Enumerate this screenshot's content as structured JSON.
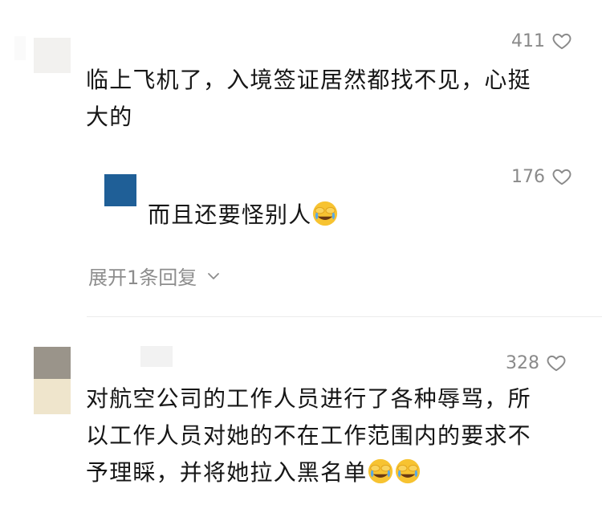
{
  "comments": [
    {
      "likes": "411",
      "text_lines": [
        "临上飞机了，入境签证居然都找不见，心挺",
        "大的"
      ]
    },
    {
      "likes": "176",
      "text": "而且还要怪别人"
    },
    {
      "likes": "328",
      "text_lines": [
        "对航空公司的工作人员进行了各种辱骂，所",
        "以工作人员对她的不在工作范围内的要求不",
        "予理睬，并将她拉入黑名单"
      ]
    }
  ],
  "expand_replies_label": "展开1条回复",
  "icons": {
    "like": "heart-outline-icon",
    "expand": "chevron-down-icon",
    "emoji": "face-with-tears-covering-eyes-emoji"
  },
  "colors": {
    "text": "#161616",
    "meta": "#8a8a8a",
    "reply_avatar": "#1f5f97"
  }
}
